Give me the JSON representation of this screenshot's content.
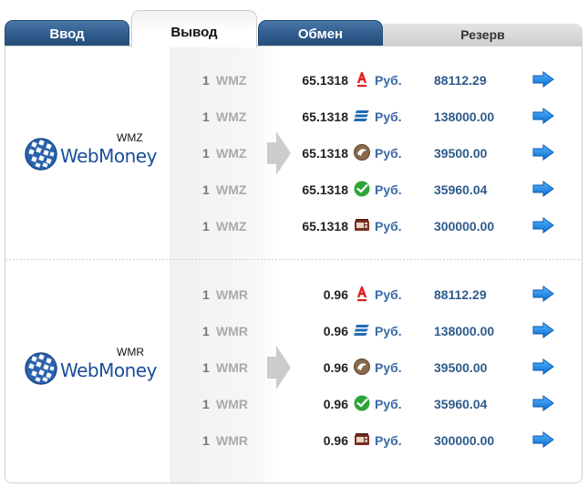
{
  "tabs": {
    "input": "Ввод",
    "output": "Вывод",
    "exchange": "Обмен",
    "reserve": "Резерв"
  },
  "colors": {
    "tab_dark": "#2f5b8c",
    "currency_link": "#3a6aa8",
    "reserve_text": "#2f5b8c",
    "go_arrow": "#1c86e6",
    "alfa_red": "#e02020",
    "sber_green": "#2fa53a"
  },
  "sections": [
    {
      "logo_text": "WebMoney",
      "logo_currency": "WMZ",
      "rows": [
        {
          "amount": "1",
          "currency": "WMZ",
          "rate": "65.1318",
          "bank_icon": "alfa-bank-icon",
          "target": "Руб.",
          "reserve": "88112.29"
        },
        {
          "amount": "1",
          "currency": "WMZ",
          "rate": "65.1318",
          "bank_icon": "vtb-bank-icon",
          "target": "Руб.",
          "reserve": "138000.00"
        },
        {
          "amount": "1",
          "currency": "WMZ",
          "rate": "65.1318",
          "bank_icon": "russian-standard-bank-icon",
          "target": "Руб.",
          "reserve": "39500.00"
        },
        {
          "amount": "1",
          "currency": "WMZ",
          "rate": "65.1318",
          "bank_icon": "sberbank-icon",
          "target": "Руб.",
          "reserve": "35960.04"
        },
        {
          "amount": "1",
          "currency": "WMZ",
          "rate": "65.1318",
          "bank_icon": "cash-terminal-icon",
          "target": "Руб.",
          "reserve": "300000.00"
        }
      ]
    },
    {
      "logo_text": "WebMoney",
      "logo_currency": "WMR",
      "rows": [
        {
          "amount": "1",
          "currency": "WMR",
          "rate": "0.96",
          "bank_icon": "alfa-bank-icon",
          "target": "Руб.",
          "reserve": "88112.29"
        },
        {
          "amount": "1",
          "currency": "WMR",
          "rate": "0.96",
          "bank_icon": "vtb-bank-icon",
          "target": "Руб.",
          "reserve": "138000.00"
        },
        {
          "amount": "1",
          "currency": "WMR",
          "rate": "0.96",
          "bank_icon": "russian-standard-bank-icon",
          "target": "Руб.",
          "reserve": "39500.00"
        },
        {
          "amount": "1",
          "currency": "WMR",
          "rate": "0.96",
          "bank_icon": "sberbank-icon",
          "target": "Руб.",
          "reserve": "35960.04"
        },
        {
          "amount": "1",
          "currency": "WMR",
          "rate": "0.96",
          "bank_icon": "cash-terminal-icon",
          "target": "Руб.",
          "reserve": "300000.00"
        }
      ]
    }
  ]
}
